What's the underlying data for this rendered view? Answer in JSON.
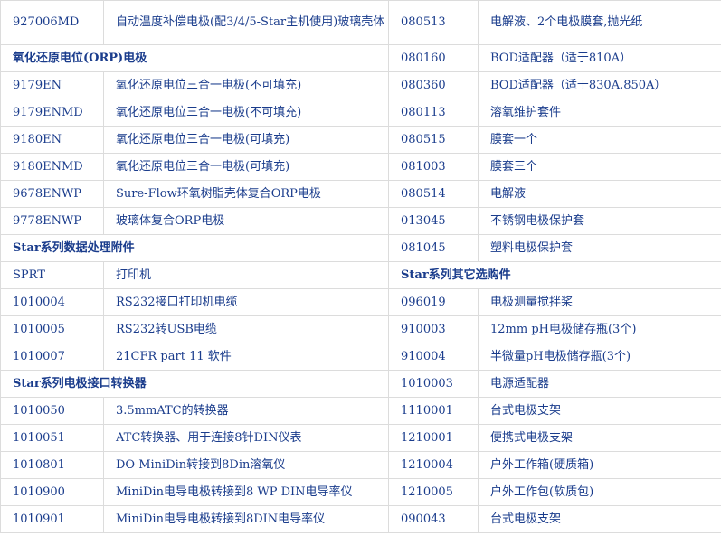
{
  "rows": [
    {
      "kind": "item",
      "left": {
        "code": "927006MD",
        "desc": "自动温度补偿电极(配3/4/5-Star主机使用)玻璃壳体"
      },
      "right": {
        "code": "080513",
        "desc": "电解液、2个电极膜套,抛光纸"
      }
    },
    {
      "kind": "lhead",
      "left": {
        "heading": "氧化还原电位(ORP)电极"
      },
      "right": {
        "code": "080160",
        "desc": "BOD适配器（适于810A）"
      }
    },
    {
      "kind": "item",
      "left": {
        "code": "9179EN",
        "desc": "氧化还原电位三合一电极(不可填充)"
      },
      "right": {
        "code": "080360",
        "desc": "BOD适配器（适于830A.850A）"
      }
    },
    {
      "kind": "item",
      "left": {
        "code": "9179ENMD",
        "desc": "氧化还原电位三合一电极(不可填充)"
      },
      "right": {
        "code": "080113",
        "desc": "溶氧维护套件"
      }
    },
    {
      "kind": "item",
      "left": {
        "code": "9180EN",
        "desc": "氧化还原电位三合一电极(可填充)"
      },
      "right": {
        "code": "080515",
        "desc": "膜套一个"
      }
    },
    {
      "kind": "item",
      "left": {
        "code": "9180ENMD",
        "desc": "氧化还原电位三合一电极(可填充)"
      },
      "right": {
        "code": "081003",
        "desc": "膜套三个"
      }
    },
    {
      "kind": "item",
      "left": {
        "code": "9678ENWP",
        "desc": "Sure-Flow环氧树脂壳体复合ORP电极"
      },
      "right": {
        "code": "080514",
        "desc": "电解液"
      }
    },
    {
      "kind": "item",
      "left": {
        "code": "9778ENWP",
        "desc": "玻璃体复合ORP电极"
      },
      "right": {
        "code": "013045",
        "desc": "不锈钢电极保护套"
      }
    },
    {
      "kind": "lhead",
      "left": {
        "heading": "Star系列数据处理附件"
      },
      "right": {
        "code": "081045",
        "desc": "塑料电极保护套"
      }
    },
    {
      "kind": "rhead",
      "left": {
        "code": "SPRT",
        "desc": "打印机"
      },
      "right": {
        "heading": "Star系列其它选购件"
      }
    },
    {
      "kind": "item",
      "left": {
        "code": "1010004",
        "desc": "RS232接口打印机电缆"
      },
      "right": {
        "code": "096019",
        "desc": "电极测量搅拌桨"
      }
    },
    {
      "kind": "item",
      "left": {
        "code": "1010005",
        "desc": "RS232转USB电缆"
      },
      "right": {
        "code": "910003",
        "desc": "12mm pH电极储存瓶(3个)"
      }
    },
    {
      "kind": "item",
      "left": {
        "code": "1010007",
        "desc": "21CFR part 11 软件"
      },
      "right": {
        "code": "910004",
        "desc": "半微量pH电极储存瓶(3个)"
      }
    },
    {
      "kind": "lhead",
      "left": {
        "heading": "Star系列电极接口转换器"
      },
      "right": {
        "code": "1010003",
        "desc": "电源适配器"
      }
    },
    {
      "kind": "item",
      "left": {
        "code": "1010050",
        "desc": "3.5mmATC的转换器"
      },
      "right": {
        "code": "1110001",
        "desc": "台式电极支架"
      }
    },
    {
      "kind": "item",
      "left": {
        "code": "1010051",
        "desc": "ATC转换器、用于连接8针DIN仪表"
      },
      "right": {
        "code": "1210001",
        "desc": "便携式电极支架"
      }
    },
    {
      "kind": "item",
      "left": {
        "code": "1010801",
        "desc": "DO MiniDin转接到8Din溶氧仪"
      },
      "right": {
        "code": "1210004",
        "desc": "户外工作箱(硬质箱)"
      }
    },
    {
      "kind": "item",
      "left": {
        "code": "1010900",
        "desc": "MiniDin电导电极转接到8 WP DIN电导率仪"
      },
      "right": {
        "code": "1210005",
        "desc": "户外工作包(软质包)"
      }
    },
    {
      "kind": "item",
      "left": {
        "code": "1010901",
        "desc": "MiniDin电导电极转接到8DIN电导率仪"
      },
      "right": {
        "code": "090043",
        "desc": "台式电极支架"
      }
    }
  ]
}
